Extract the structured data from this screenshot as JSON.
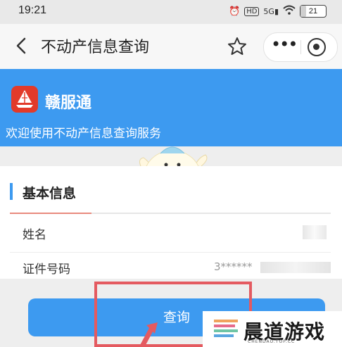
{
  "status_bar": {
    "time": "19:21",
    "icons": [
      "alarm-icon",
      "hd-icon",
      "5g-signal-icon",
      "wifi-icon"
    ],
    "battery": {
      "level_label": "21",
      "level": 0.21
    }
  },
  "header": {
    "title": "不动产信息查询",
    "icons": [
      "back-icon",
      "star-icon",
      "more-icon",
      "target-icon"
    ]
  },
  "banner": {
    "app_name": "赣服通",
    "welcome": "欢迎使用不动产信息查询服务"
  },
  "form": {
    "section_title": "基本信息",
    "fields": [
      {
        "label": "姓名",
        "value": ""
      },
      {
        "label": "证件号码",
        "value": "3******"
      }
    ]
  },
  "query_button": {
    "label": "查询"
  },
  "watermark": {
    "text": "晨道游戏",
    "sub": "CHENDAO.TOP.CC"
  },
  "colors": {
    "accent": "#3d9af0",
    "annotation": "#e45a60",
    "logo": "#e23a2a"
  }
}
